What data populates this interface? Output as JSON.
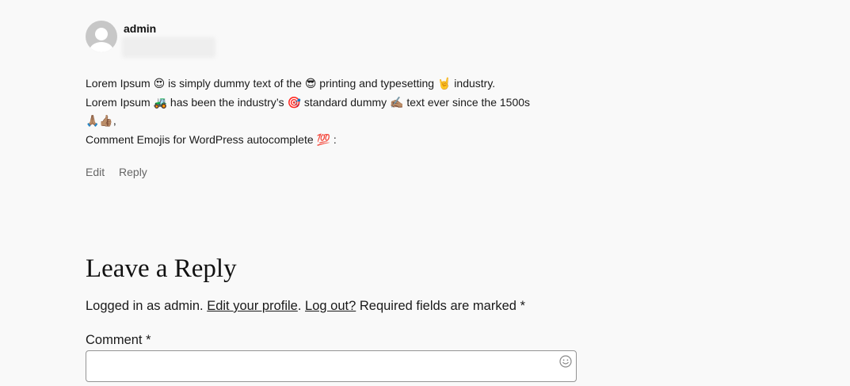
{
  "comment": {
    "author": "admin",
    "paragraphs": [
      {
        "parts": [
          "Lorem Ipsum ",
          "😍",
          " is simply dummy text of the ",
          "😎",
          " printing and typesetting ",
          "🤘",
          " industry."
        ]
      },
      {
        "parts": [
          "Lorem Ipsum ",
          "🚜",
          " has been the industry’s ",
          "🎯",
          " standard dummy ",
          "✍🏽",
          " text ever since the 1500s"
        ]
      },
      {
        "parts": [
          "🙏🏽👍🏽",
          ","
        ]
      },
      {
        "parts": [
          "Comment Emojis for WordPress autocomplete ",
          "💯",
          " :"
        ]
      }
    ],
    "actions": {
      "edit": "Edit",
      "reply": "Reply"
    }
  },
  "reply_form": {
    "title": "Leave a Reply",
    "logged_in_prefix": "Logged in as admin.",
    "edit_profile": "Edit your profile",
    "period": ".",
    "log_out": "Log out?",
    "required_note": "Required fields are marked",
    "required_marker": "*",
    "comment_label": "Comment",
    "comment_value": ""
  },
  "colors": {
    "background": "#f9f9f9",
    "text": "#111111",
    "muted": "#666666",
    "border": "#949494"
  },
  "icons": {
    "emoji_picker": "smiley-face-icon",
    "avatar": "default-avatar-icon"
  }
}
